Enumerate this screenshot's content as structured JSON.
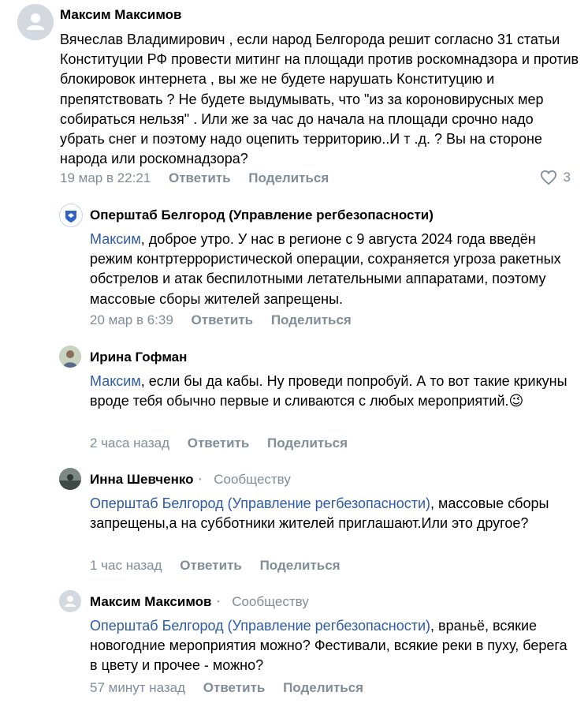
{
  "comments": [
    {
      "author": "Максим Максимов",
      "text": "Вячеслав Владимирович , если народ Белгорода решит согласно 31 статьи Конституции РФ провести митинг на площади против роскомнадзора и против блокировок интернета , вы же не будете нарушать Конституцию и препятствовать ? Не будете выдумывать, что \"из за короновирусных мер собираться нельзя\" . Или же за час до начала на площади срочно надо убрать снег и поэтому надо оцепить территорию..И т .д. ? Вы на стороне народа или роскомнадзора?",
      "time": "19 мар в 22:21",
      "reply": "Ответить",
      "share": "Поделиться",
      "likes": "3"
    },
    {
      "author": "Оперштаб Белгород (Управление регбезопасности)",
      "mention": "Максим",
      "text": ", доброе утро. У нас в регионе с 9 августа 2024 года введён режим контртеррористической операции, сохраняется угроза ракетных обстрелов и атак беспилотными летательными аппаратами, поэтому массовые сборы жителей запрещены.",
      "time": "20 мар в 6:39",
      "reply": "Ответить",
      "share": "Поделиться"
    },
    {
      "author": "Ирина Гофман",
      "mention": "Максим",
      "text": ", если бы да кабы. Ну проведи попробуй. А то вот такие крикуны вроде тебя обычно первые и сливаются с любых мероприятий.",
      "emoji": "😉",
      "time": "2 часа назад",
      "reply": "Ответить",
      "share": "Поделиться"
    },
    {
      "author": "Инна Шевченко",
      "community": "Сообществу",
      "mention": "Оперштаб Белгород (Управление регбезопасности)",
      "text": ", массовые сборы запрещены,а на субботники жителей приглашают.Или это другое?",
      "time": "1 час назад",
      "reply": "Ответить",
      "share": "Поделиться"
    },
    {
      "author": "Максим Максимов",
      "community": "Сообществу",
      "mention": "Оперштаб Белгород (Управление регбезопасности)",
      "text": ", враньё, всякие новогодние мероприятия можно? Фестивали, всякие реки в пуху, берега в цвету и прочее - можно?",
      "time": "57 минут назад",
      "reply": "Ответить",
      "share": "Поделиться"
    }
  ],
  "icons": {
    "like": "heart-icon",
    "default_avatar": "user-silhouette-icon",
    "community_avatar": "belgorod-emblem-icon"
  },
  "colors": {
    "link": "#2d5aa8",
    "secondary": "#818c99",
    "avatar_placeholder": "#d3d9df",
    "emblem_blue": "#2f63c5"
  }
}
